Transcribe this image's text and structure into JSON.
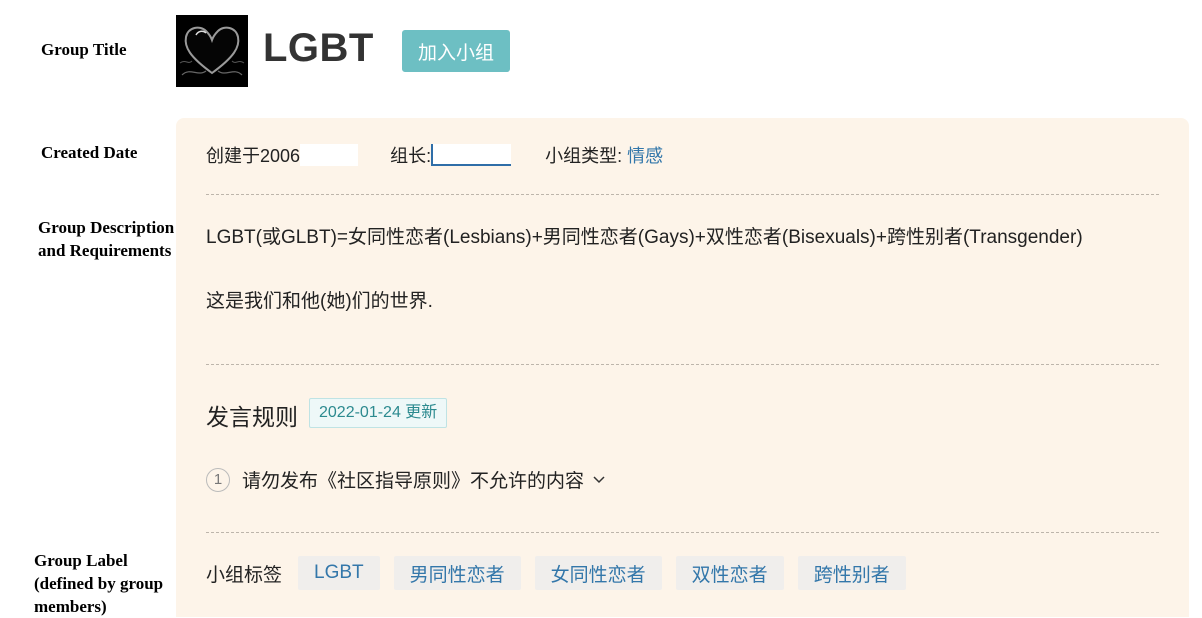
{
  "annotations": {
    "group_title": "Group Title",
    "created_date": "Created Date",
    "group_description_line1": "Group Description",
    "group_description_line2": "and Requirements",
    "group_label_line1": "Group Label",
    "group_label_line2": "(defined by group",
    "group_label_line3": "members)"
  },
  "group": {
    "name": "LGBT",
    "join_button": "加入小组",
    "avatar_icon": "black-heart-icon"
  },
  "meta": {
    "created_prefix": "创建于2006",
    "owner_label": "组长:",
    "type_label": "小组类型:",
    "type_value": "情感"
  },
  "description": {
    "line1": "LGBT(或GLBT)=女同性恋者(Lesbians)+男同性恋者(Gays)+双性恋者(Bisexuals)+跨性别者(Transgender)",
    "line2": "这是我们和他(她)们的世界."
  },
  "rules": {
    "title": "发言规则",
    "updated_badge": "2022-01-24 更新",
    "items": [
      {
        "number": "1",
        "text": "请勿发布《社区指导原则》不允许的内容"
      }
    ]
  },
  "tags": {
    "label": "小组标签",
    "items": [
      "LGBT",
      "男同性恋者",
      "女同性恋者",
      "双性恋者",
      "跨性别者"
    ]
  },
  "colors": {
    "accent": "#6dbfc3",
    "link": "#3377aa",
    "panel_bg": "#fdf4e9"
  }
}
